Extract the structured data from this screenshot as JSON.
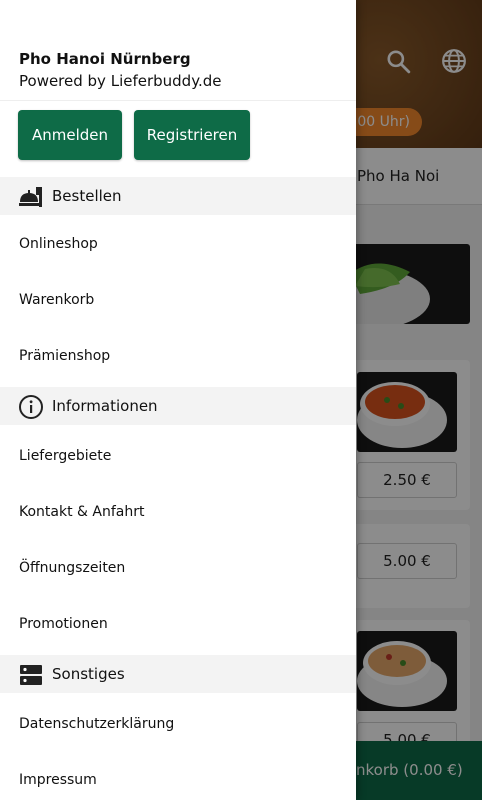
{
  "background": {
    "restaurant_name": "Pho Ha Noi",
    "hours_pill": "(:00 Uhr)",
    "prices": [
      "2.50 €",
      "5.00 €",
      "5.00 €"
    ],
    "cart_label": "nkorb (0.00 €)",
    "icons": [
      "search-icon",
      "globe-icon"
    ]
  },
  "drawer": {
    "title": "Pho Hanoi Nürnberg",
    "subtitle": "Powered by Lieferbuddy.de",
    "buttons": {
      "login": "Anmelden",
      "register": "Registrieren"
    },
    "sections": [
      {
        "label": "Bestellen",
        "icon": "food-tray-icon",
        "items": [
          "Onlineshop",
          "Warenkorb",
          "Prämienshop"
        ]
      },
      {
        "label": "Informationen",
        "icon": "info-icon",
        "items": [
          "Liefergebiete",
          "Kontakt & Anfahrt",
          "Öffnungszeiten",
          "Promotionen"
        ]
      },
      {
        "label": "Sonstiges",
        "icon": "server-icon",
        "items": [
          "Datenschutzerklärung",
          "Impressum"
        ]
      }
    ]
  },
  "colors": {
    "primary": "#0e6b47",
    "accent": "#f4892c"
  }
}
